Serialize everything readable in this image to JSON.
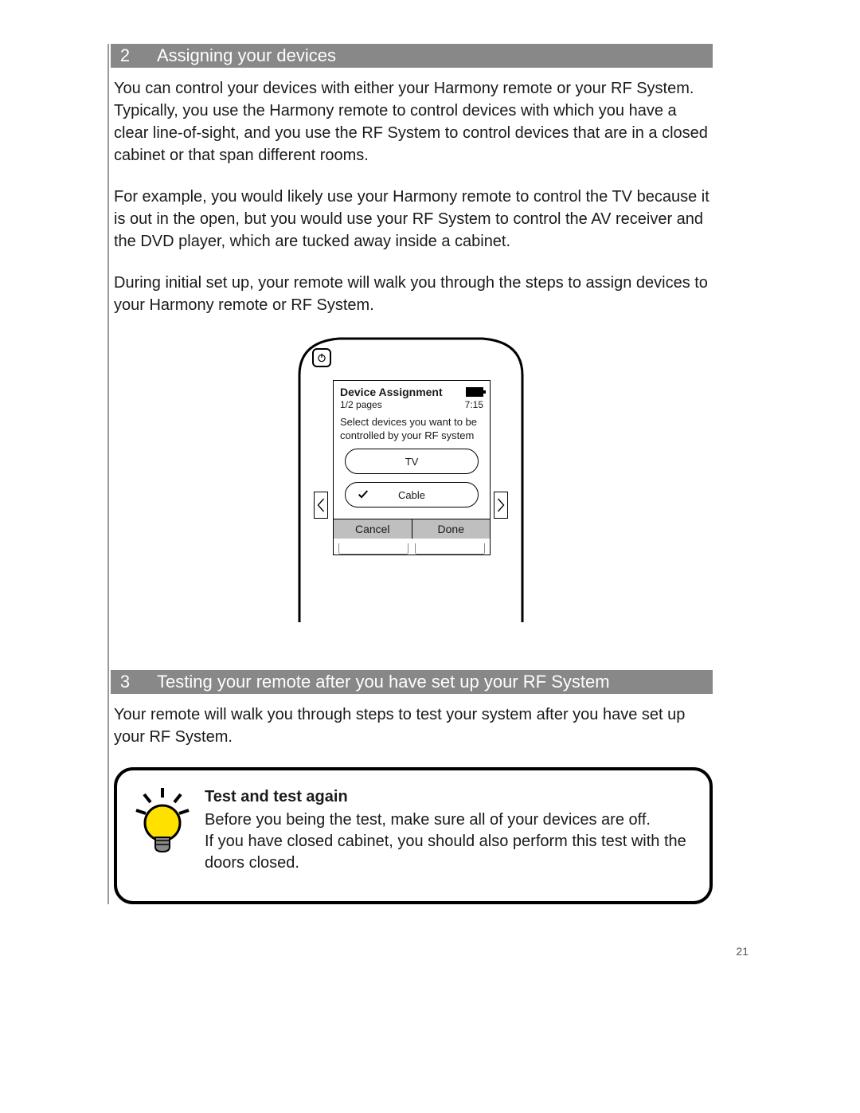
{
  "section2": {
    "number": "2",
    "title": "Assigning your devices",
    "p1": "You can control your devices with either your Harmony remote or your RF System. Typically, you use the Harmony remote to control devices with which you have a clear line-of-sight, and you use the RF System to control devices that are in a closed cabinet or that span different rooms.",
    "p2": "For example, you would likely use your Harmony remote to control the TV because it is out in the open, but you would use your RF System to control the AV receiver and the DVD player, which are tucked away inside a cabinet.",
    "p3": "During initial set up, your remote will walk you through the steps to assign devices to your Harmony remote or RF System."
  },
  "remote_screen": {
    "title": "Device Assignment",
    "pages": "1/2 pages",
    "time": "7:15",
    "instruction": "Select devices you want to be controlled by your RF system",
    "device1": "TV",
    "device2": "Cable",
    "cancel": "Cancel",
    "done": "Done"
  },
  "section3": {
    "number": "3",
    "title": "Testing your remote after you have set up your RF System",
    "p1": "Your remote will walk you through steps to test your system after you have set up your RF System."
  },
  "tip": {
    "title": "Test and test again",
    "line1": "Before you being the test, make sure all of your devices are off.",
    "line2": "If you have closed cabinet, you should also perform this test with the doors closed."
  },
  "page_number": "21"
}
